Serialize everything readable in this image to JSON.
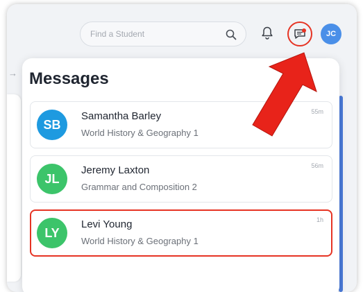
{
  "header": {
    "search_placeholder": "Find a Student",
    "user_initials": "JC"
  },
  "panel": {
    "title": "Messages",
    "messages": [
      {
        "initials": "SB",
        "name": "Samantha Barley",
        "course": "World History & Geography 1",
        "time": "55m",
        "avatar_color": "#1e9ae0"
      },
      {
        "initials": "JL",
        "name": "Jeremy Laxton",
        "course": "Grammar and Composition 2",
        "time": "56m",
        "avatar_color": "#3cc46a"
      },
      {
        "initials": "LY",
        "name": "Levi Young",
        "course": "World History & Geography 1",
        "time": "1h",
        "avatar_color": "#3cc46a"
      }
    ]
  },
  "colors": {
    "highlight": "#e63323",
    "accent_blue": "#4a8fe8"
  },
  "icons": [
    "search-icon",
    "bell-icon",
    "chat-icon",
    "arrow-right-icon",
    "red-arrow-pointer"
  ]
}
